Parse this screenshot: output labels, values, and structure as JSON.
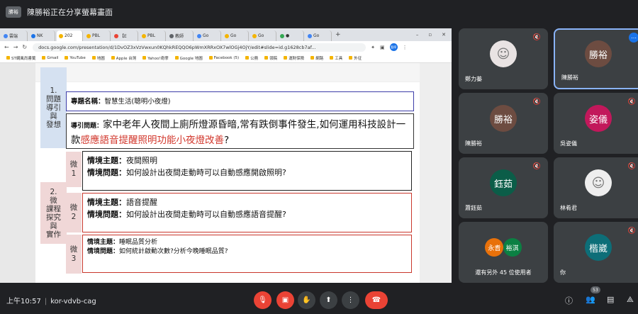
{
  "presenter": {
    "badge": "勝裕",
    "text": "陳勝裕正在分享螢幕畫面"
  },
  "browser": {
    "tabs": [
      {
        "label": "雲端",
        "color": "#4285f4"
      },
      {
        "label": "NK",
        "color": "#1a73e8"
      },
      {
        "label": "202",
        "color": "#f4b400"
      },
      {
        "label": "PBL",
        "color": "#f4b400"
      },
      {
        "label": "【E",
        "color": "#ea4335"
      },
      {
        "label": "PBL",
        "color": "#f4b400"
      },
      {
        "label": "教師",
        "color": "#5f6368"
      },
      {
        "label": "Go",
        "color": "#4285f4"
      },
      {
        "label": "Go",
        "color": "#f4b400"
      },
      {
        "label": "Go",
        "color": "#f4b400"
      },
      {
        "label": "●",
        "color": "#34a853"
      },
      {
        "label": "Go",
        "color": "#4285f4"
      }
    ],
    "url": "docs.google.com/presentation/d/1DvOZ3xVzVwxun0KQhkREQQO6pWmXRRxOX7wlOGj4OjY/edit#slide=id.g1628cb7af...",
    "profile": "暫停",
    "bookmarks": [
      "ST網風尚書籤",
      "Gmail",
      "YouTube",
      "地圖",
      "Apple 台灣",
      "Yahoo!奇摩",
      "Google 地圖",
      "Facebook (5)",
      "公務",
      "領稿",
      "運財保險",
      "網路",
      "工具",
      "外征"
    ]
  },
  "slide": {
    "block1_head": "1.\n問題\n導引\n與\n發想",
    "block2_head": "2.\n微\n課程\n探究\n與\n實作",
    "topic_label": "專題名稱：",
    "topic_value": "智慧生活(聰明小夜燈)",
    "question_label": "導引問題：",
    "question_text_a": "家中老年人夜間上廁所燈源昏暗,常有跌倒事件發生,如何運用科技設計一款",
    "question_text_red": "感應語音提醒照明功能小夜燈改善",
    "question_text_b": "?",
    "micro": [
      {
        "label": "微\n1",
        "theme_label": "情境主題：",
        "theme": "夜間照明",
        "q_label": "情境問題：",
        "q": "如何設計出夜間走動時可以自動感應開啟照明?"
      },
      {
        "label": "微\n2",
        "theme_label": "情境主題：",
        "theme": "語音提醒",
        "q_label": "情境問題：",
        "q": "如何設計出夜間走動時可以自動感應語音提醒?"
      },
      {
        "label": "微\n3",
        "theme_label": "情境主題：",
        "theme": "睡眠品質分析",
        "q_label": "情境問題：",
        "q": "如何統計啟動次數?分析今晚睡眠品質?"
      }
    ]
  },
  "participants": [
    {
      "name": "鄭力蓁",
      "avatar_text": "",
      "avatar_color": "#e9e3e3",
      "photo": true
    },
    {
      "name": "陳勝裕",
      "avatar_text": "勝裕",
      "avatar_color": "#6d4c41",
      "selected": true
    },
    {
      "name": "陳勝裕",
      "avatar_text": "勝裕",
      "avatar_color": "#6d4c41"
    },
    {
      "name": "吳姿儀",
      "avatar_text": "姿儀",
      "avatar_color": "#c2185b"
    },
    {
      "name": "蕭鈺茹",
      "avatar_text": "鈺茹",
      "avatar_color": "#0b5d48"
    },
    {
      "name": "林肴君",
      "avatar_text": "",
      "avatar_color": "#eeeeee",
      "photo": true
    },
    {
      "name": "還有另外 45 位使用者",
      "avatar_text": "",
      "others": [
        "永耆",
        "裕淇"
      ]
    },
    {
      "name": "你",
      "avatar_text": "楷崴",
      "avatar_color": "#0d6e78"
    }
  ],
  "bottom": {
    "time": "上午10:57",
    "meeting_code": "kor-vdvb-cag",
    "people_count": "53"
  },
  "colors": {
    "end_call": "#ea4335",
    "bar_bg": "#202124"
  }
}
